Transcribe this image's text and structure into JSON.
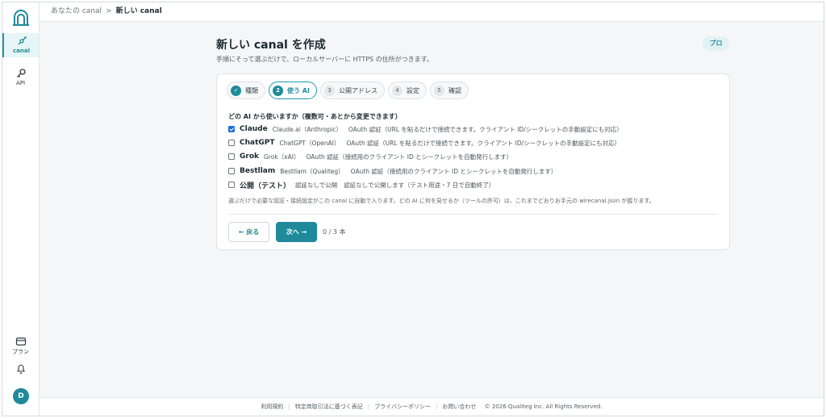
{
  "sidebar": {
    "logo_icon": "canal-arch-logo",
    "items": [
      {
        "label": "canal",
        "icon": "canal-icon",
        "active": true
      },
      {
        "label": "API",
        "icon": "key-icon",
        "active": false
      },
      {
        "label": "プラン",
        "icon": "plan-card-icon",
        "active": false
      }
    ],
    "bell_icon": "bell-icon",
    "avatar_initial": "D"
  },
  "breadcrumb": {
    "parent": "あなたの canal",
    "separator": ">",
    "current": "新しい canal"
  },
  "header": {
    "title": "新しい canal を作成",
    "subtitle": "手順にそって選ぶだけで、ローカルサーバーに HTTPS の住所がつきます。",
    "badge": "プロ"
  },
  "steps": [
    {
      "num": "✓",
      "label": "種類",
      "state": "done"
    },
    {
      "num": "2",
      "label": "使う AI",
      "state": "active"
    },
    {
      "num": "3",
      "label": "公開アドレス",
      "state": "pending"
    },
    {
      "num": "4",
      "label": "設定",
      "state": "pending"
    },
    {
      "num": "5",
      "label": "確認",
      "state": "pending"
    }
  ],
  "question": "どの AI から使いますか（複数可・あとから変更できます）",
  "options": [
    {
      "name": "Claude",
      "provider": "Claude.ai（Anthropic）",
      "desc": "OAuth 認証（URL を貼るだけで接続できます。クライアント ID/シークレットの手動設定にも対応）",
      "checked": true
    },
    {
      "name": "ChatGPT",
      "provider": "ChatGPT（OpenAI）",
      "desc": "OAuth 認証（URL を貼るだけで接続できます。クライアント ID/シークレットの手動設定にも対応）",
      "checked": false
    },
    {
      "name": "Grok",
      "provider": "Grok（xAI）",
      "desc": "OAuth 認証（接続用のクライアント ID とシークレットを自動発行します）",
      "checked": false
    },
    {
      "name": "Bestllam",
      "provider": "Bestllam（Qualiteg）",
      "desc": "OAuth 認証（接続用のクライアント ID とシークレットを自動発行します）",
      "checked": false
    },
    {
      "name": "公開（テスト）",
      "provider": "認証なしで公開",
      "desc": "認証なしで公開します（テスト用途・7 日で自動終了）",
      "checked": false
    }
  ],
  "note": "選ぶだけで必要な認証・接続設定がこの canal に自動で入ります。どの AI に何を見せるか（ツールの許可）は、これまでどおりお手元の wirecanal.json が握ります。",
  "actions": {
    "back": "← 戻る",
    "next": "次へ →",
    "count": "0 / 3 本"
  },
  "footer": {
    "links": [
      "利用規約",
      "特定商取引法に基づく表記",
      "プライバシーポリシー",
      "お問い合わせ"
    ],
    "copyright": "© 2026 Qualiteg Inc. All Rights Reserved."
  },
  "colors": {
    "accent": "#1e8a9a",
    "checkbox": "#1e6fd9"
  }
}
